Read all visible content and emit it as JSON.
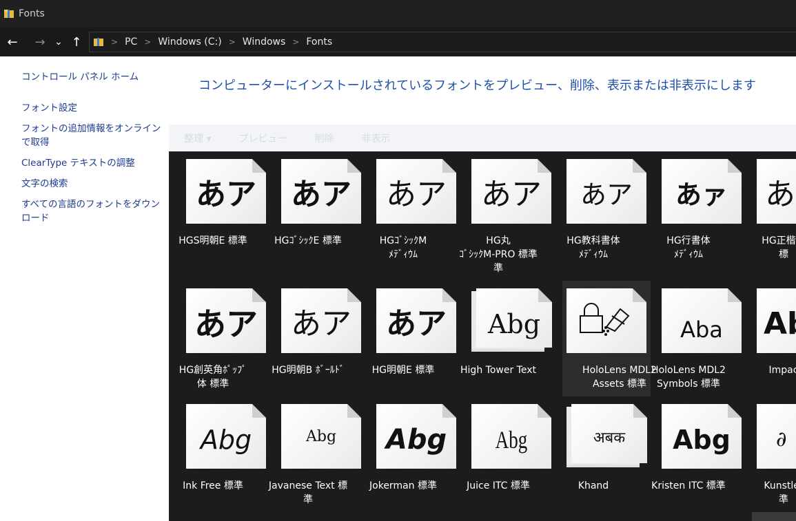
{
  "window": {
    "title": "Fonts"
  },
  "nav": {
    "back": "←",
    "forward": "→",
    "recent": "⌄",
    "up": "↑"
  },
  "breadcrumb": [
    "PC",
    "Windows (C:)",
    "Windows",
    "Fonts"
  ],
  "sidebar": {
    "items": [
      {
        "label": "コントロール パネル ホーム"
      },
      {
        "label": "フォント設定"
      },
      {
        "label": "フォントの追加情報をオンラインで取得"
      },
      {
        "label": "ClearType テキストの調整"
      },
      {
        "label": "文字の検索"
      },
      {
        "label": "すべての言語のフォントをダウンロード"
      }
    ]
  },
  "main": {
    "heading": "コンピューターにインストールされているフォントをプレビュー、削除、表示または非表示にします",
    "toolbar": [
      "整理 ▾",
      "プレビュー",
      "削除",
      "非表示"
    ]
  },
  "fonts": [
    {
      "glyph": "あア",
      "line1": "HGS明朝E 標準",
      "line2": ""
    },
    {
      "glyph": "あア",
      "line1": "HGｺﾞｼｯｸE 標準",
      "line2": ""
    },
    {
      "glyph": "あア",
      "line1": "HGｺﾞｼｯｸM",
      "line2": "ﾒﾃﾞｨｳﾑ"
    },
    {
      "glyph": "あア",
      "line1": "HG丸",
      "line2": "ｺﾞｼｯｸM-PRO 標準"
    },
    {
      "glyph": "あア",
      "line1": "HG教科書体",
      "line2": "ﾒﾃﾞｨｳﾑ"
    },
    {
      "glyph": "あァ",
      "line1": "HG行書体",
      "line2": "ﾒﾃﾞｨｳﾑ"
    },
    {
      "glyph": "あ",
      "line1": "HG正楷書",
      "line2": "標"
    },
    {
      "glyph": "あア",
      "line1": "HG創英角ﾎﾟｯﾌﾟ",
      "line2": "体 標準"
    },
    {
      "glyph": "あア",
      "line1": "HG明朝B ﾎﾞｰﾙﾄﾞ",
      "line2": ""
    },
    {
      "glyph": "あア",
      "line1": "HG明朝E 標準",
      "line2": ""
    },
    {
      "glyph": "Abg",
      "line1": "High Tower Text",
      "line2": ""
    },
    {
      "glyph": "",
      "line1": "HoloLens MDL2",
      "line2": "Assets 標準"
    },
    {
      "glyph": "Aba",
      "line1": "HoloLens MDL2",
      "line2": "Symbols 標準"
    },
    {
      "glyph": "Ab",
      "line1": "Impac",
      "line2": ""
    },
    {
      "glyph": "Abg",
      "line1": "Ink Free 標準",
      "line2": ""
    },
    {
      "glyph": "Abg",
      "line1": "Javanese Text 標",
      "line2": "準"
    },
    {
      "glyph": "Abg",
      "line1": "Jokerman 標準",
      "line2": ""
    },
    {
      "glyph": "Abg",
      "line1": "Juice ITC 標準",
      "line2": ""
    },
    {
      "glyph": "अबक",
      "line1": "Khand",
      "line2": ""
    },
    {
      "glyph": "Abg",
      "line1": "Kristen ITC 標準",
      "line2": ""
    },
    {
      "glyph": "∂",
      "line1": "Kunstler",
      "line2": "準"
    }
  ]
}
